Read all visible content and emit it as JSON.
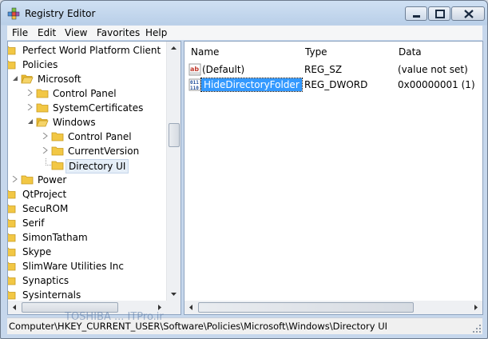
{
  "window": {
    "title": "Registry Editor"
  },
  "menu": {
    "file": "File",
    "edit": "Edit",
    "view": "View",
    "favorites": "Favorites",
    "help": "Help"
  },
  "tree": {
    "items": [
      {
        "label": "Perfect World Platform Client"
      },
      {
        "label": "Policies"
      },
      {
        "label": "Microsoft"
      },
      {
        "label": "Control Panel"
      },
      {
        "label": "SystemCertificates"
      },
      {
        "label": "Windows"
      },
      {
        "label": "Control Panel"
      },
      {
        "label": "CurrentVersion"
      },
      {
        "label": "Directory UI"
      },
      {
        "label": "Power"
      },
      {
        "label": "QtProject"
      },
      {
        "label": "SecuROM"
      },
      {
        "label": "Serif"
      },
      {
        "label": "SimonTatham"
      },
      {
        "label": "Skype"
      },
      {
        "label": "SlimWare Utilities Inc"
      },
      {
        "label": "Synaptics"
      },
      {
        "label": "Sysinternals"
      }
    ]
  },
  "list": {
    "columns": {
      "name": "Name",
      "type": "Type",
      "data": "Data"
    },
    "rows": [
      {
        "name": "(Default)",
        "type": "REG_SZ",
        "data": "(value not set)",
        "icon": "string-value-icon"
      },
      {
        "name": "HideDirectoryFolder",
        "type": "REG_DWORD",
        "data": "0x00000001 (1)",
        "icon": "dword-value-icon"
      }
    ]
  },
  "statusbar": {
    "path": "Computer\\HKEY_CURRENT_USER\\Software\\Policies\\Microsoft\\Windows\\Directory UI"
  },
  "watermark": {
    "text": "TOSHIBA ... ITPro.ir"
  },
  "colors": {
    "selection": "#3399ff",
    "folder": "#f2c744"
  }
}
